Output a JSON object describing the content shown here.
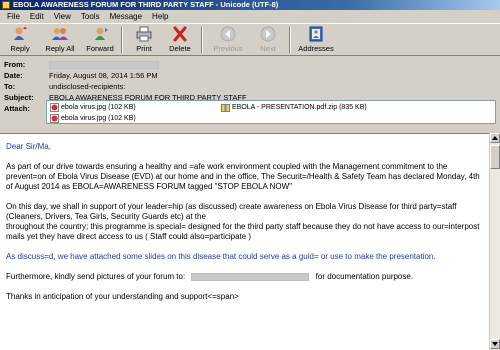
{
  "window": {
    "title": "EBOLA AWARENESS FORUM FOR THIRD PARTY STAFF - Unicode (UTF-8)"
  },
  "menu": [
    "File",
    "Edit",
    "View",
    "Tools",
    "Message",
    "Help"
  ],
  "toolbar": {
    "reply": "Reply",
    "reply_all": "Reply All",
    "forward": "Forward",
    "print": "Print",
    "delete": "Delete",
    "previous": "Previous",
    "next": "Next",
    "addresses": "Addresses"
  },
  "header": {
    "from_label": "From:",
    "date_label": "Date:",
    "date_value": "Friday, August 08, 2014 1:56 PM",
    "to_label": "To:",
    "to_value": "undisclosed-recipients:",
    "subject_label": "Subject:",
    "subject_value": "EBOLA AWARENESS FORUM FOR THIRD PARTY STAFF",
    "attach_label": "Attach:",
    "attachments": [
      "ebola virus.jpg (102 KB)",
      "ebola virus.jpg (102 KB)",
      "EBOLA - PRESENTATION.pdf.zip (835 KB)"
    ]
  },
  "body": {
    "greeting": "Dear Sir/Ma,",
    "p1": "As part of our drive towards ensuring a healthy and =afe work environment coupled with the Management commitment to the prevent=on of Ebola Virus Disease (EVD) at our home and in the office, The Securit=/Health & Safety Team has declared Monday, 4th of August 2014 as EBOLA=AWARENESS FORUM tagged \"STOP EBOLA NOW\"",
    "p2_line1": "On this day, we shall in support of your leader=hip (as discussed) create awareness on Ebola Virus Disease for third party=staff (Cleaners, Drivers, Tea Girls, Security Guards etc) at the",
    "p2_line2": "throughout the country; this programme is special= designed for the third party staff because they do not have access to our=interpost mails yet they have direct access to us  ( Staff could also=participate )",
    "p3": "As discuss=d, we have attached some slides on this disease that could serve as a guid= or use to make the presentation.",
    "p4_before": "Furthermore, kindly send pictures of your forum to:",
    "p4_after": "for documentation purpose.",
    "p5": "Thanks in anticipation of your understanding and support<=span>"
  },
  "colors": {
    "title_gradient_start": "#0a246a",
    "link_blue": "#1f3fa0",
    "chrome": "#d4d0c8"
  }
}
